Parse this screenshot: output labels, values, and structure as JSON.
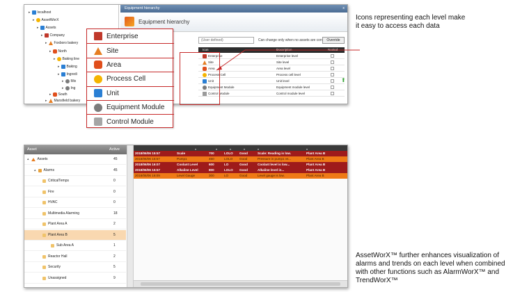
{
  "top": {
    "tree": [
      {
        "label": "localhost",
        "icon": "server-icon"
      },
      {
        "label": "AssetWorX",
        "icon": "assetworx-icon"
      },
      {
        "label": "Assets",
        "icon": "assets-icon"
      },
      {
        "label": "Company",
        "icon": "enterprise-icon"
      },
      {
        "label": "Foxboro bakery",
        "icon": "site-icon"
      },
      {
        "label": "North",
        "icon": "area-icon"
      },
      {
        "label": "Baking line",
        "icon": "cell-icon"
      },
      {
        "label": "Baking",
        "icon": "unit-icon"
      },
      {
        "label": "Ingredi",
        "icon": "unit-icon"
      },
      {
        "label": "Mix",
        "icon": "equipment-icon"
      },
      {
        "label": "Ing",
        "icon": "equipment-icon"
      },
      {
        "label": "South",
        "icon": "area-icon"
      },
      {
        "label": "Mansfield bakery",
        "icon": "site-icon"
      }
    ],
    "tab_label": "Equipment hierarchy",
    "close_glyph": "x",
    "header_title": "Equipment hierarchy",
    "input_value": "(User defined)",
    "note": "Can change only when no assets are configured.",
    "override_label": "Override",
    "grid_headers": [
      "Icon",
      "Description",
      "Nested"
    ],
    "grid_rows": [
      {
        "name": "Enterprise",
        "description": "Enterprise level",
        "icon": "enterprise-icon"
      },
      {
        "name": "Site",
        "description": "Site level",
        "icon": "site-icon"
      },
      {
        "name": "Area",
        "description": "Area level",
        "icon": "area-icon"
      },
      {
        "name": "Process Cell",
        "description": "Process cell level",
        "icon": "cell-icon"
      },
      {
        "name": "Unit",
        "description": "Unit level",
        "icon": "unit-icon"
      },
      {
        "name": "Equipment Module",
        "description": "Equipment module level",
        "icon": "equipment-icon"
      },
      {
        "name": "Control Module",
        "description": "Control module level",
        "icon": "control-module-icon"
      }
    ],
    "callout_items": [
      {
        "label": "Enterprise",
        "icon": "enterprise-icon"
      },
      {
        "label": "Site",
        "icon": "site-icon"
      },
      {
        "label": "Area",
        "icon": "area-icon"
      },
      {
        "label": "Process Cell",
        "icon": "cell-icon"
      },
      {
        "label": "Unit",
        "icon": "unit-icon"
      },
      {
        "label": "Equipment Module",
        "icon": "equipment-icon"
      },
      {
        "label": "Control Module",
        "icon": "control-module-icon"
      }
    ],
    "annotation": "Icons representing each level make it easy to access each data"
  },
  "bottom": {
    "asset_header": "Asset",
    "active_header": "Active",
    "assets": [
      {
        "label": "Assets",
        "count": "45",
        "indent": 0,
        "icon": "site-icon"
      },
      {
        "label": "Alarms",
        "count": "45",
        "indent": 1,
        "icon": "alarm-icon"
      },
      {
        "label": "CriticalTemps",
        "count": "0",
        "indent": 2,
        "icon": "folder-icon"
      },
      {
        "label": "Fire",
        "count": "0",
        "indent": 2,
        "icon": "folder-icon"
      },
      {
        "label": "HVAC",
        "count": "0",
        "indent": 2,
        "icon": "folder-icon"
      },
      {
        "label": "Multimedia Alarming",
        "count": "18",
        "indent": 2,
        "icon": "folder-icon"
      },
      {
        "label": "Plant Area A",
        "count": "2",
        "indent": 2,
        "icon": "folder-icon"
      },
      {
        "label": "Plant Area B",
        "count": "5",
        "indent": 2,
        "icon": "folder-icon",
        "selected": true
      },
      {
        "label": "Sub Area A",
        "count": "1",
        "indent": 3,
        "icon": "folder-icon"
      },
      {
        "label": "Reactor Hall",
        "count": "2",
        "indent": 2,
        "icon": "folder-icon"
      },
      {
        "label": "Security",
        "count": "5",
        "indent": 2,
        "icon": "folder-icon"
      },
      {
        "label": "Unassigned",
        "count": "9",
        "indent": 2,
        "icon": "folder-icon"
      }
    ],
    "alarms": [
      {
        "time": "2018/06/06 15:57",
        "tag": "Scale",
        "value": "700",
        "limit": "LOLO",
        "quality": "Good",
        "message": "Scale: Reading is low.",
        "area": "Plant Area B",
        "style": "red"
      },
      {
        "time": "2018/06/06 15:57",
        "tag": "Pump1",
        "value": "450",
        "limit": "LOLO",
        "quality": "Good",
        "message": "Pressure in pump1 vs...",
        "area": "Plant Area B",
        "style": "orange"
      },
      {
        "time": "2018/06/06 16:07",
        "tag": "Coolant Level",
        "value": "600",
        "limit": "LO",
        "quality": "Good",
        "message": "Coolant level is low...",
        "area": "Plant Area B",
        "style": "red"
      },
      {
        "time": "2018/06/06 15:57",
        "tag": "Alkaline Level",
        "value": "800",
        "limit": "LOLO",
        "quality": "Good",
        "message": "Alkaline level in...",
        "area": "Plant Area B",
        "style": "red"
      },
      {
        "time": "2018/06/06 16:09",
        "tag": "Level Gauge",
        "value": "300",
        "limit": "LO",
        "quality": "Good",
        "message": "Level gauge is low.",
        "area": "Plant Area B",
        "style": "orange"
      }
    ],
    "annotation": "AssetWorX™ further enhances visualization of alarms and trends on each level when combined with other functions such as AlarmWorX™ and TrendWorX™"
  },
  "colors": {
    "accent_red": "#c62828",
    "alarm_red": "#9e1b1b",
    "alarm_orange": "#ef7a16",
    "selection": "#f9d8b0"
  }
}
